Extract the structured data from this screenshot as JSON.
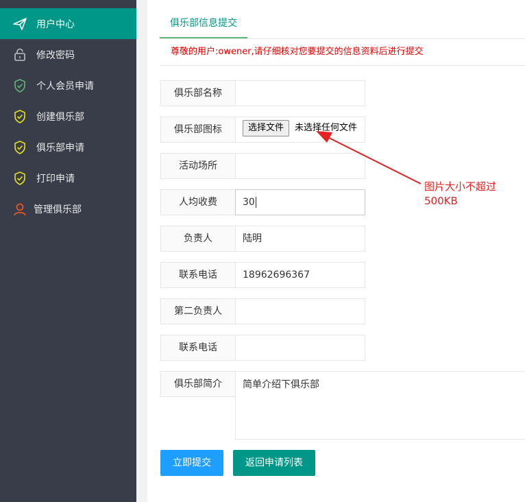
{
  "sidebar": {
    "items": [
      {
        "label": "用户中心",
        "icon": "paper-plane-icon",
        "active": true
      },
      {
        "label": "修改密码",
        "icon": "lock-icon"
      },
      {
        "label": "个人会员申请",
        "icon": "shield-check-icon"
      },
      {
        "label": "创建俱乐部",
        "icon": "shield-check-icon"
      },
      {
        "label": "俱乐部申请",
        "icon": "shield-check-icon"
      },
      {
        "label": "打印申请",
        "icon": "shield-check-icon"
      },
      {
        "label": "管理俱乐部",
        "icon": "user-icon"
      }
    ]
  },
  "tabs": {
    "active_label": "俱乐部信息提交"
  },
  "notice": "尊敬的用户:owener,请仔细核对您要提交的信息资料后进行提交",
  "form": {
    "club_name": {
      "label": "俱乐部名称",
      "value": ""
    },
    "club_icon": {
      "label": "俱乐部图标",
      "button": "选择文件",
      "status": "未选择任何文件"
    },
    "venue": {
      "label": "活动场所",
      "value": ""
    },
    "fee": {
      "label": "人均收费",
      "value": "30"
    },
    "leader": {
      "label": "负责人",
      "value": "陆明"
    },
    "phone": {
      "label": "联系电话",
      "value": "18962696367"
    },
    "second_leader": {
      "label": "第二负责人",
      "value": ""
    },
    "second_phone": {
      "label": "联系电话",
      "value": ""
    },
    "intro": {
      "label": "俱乐部简介",
      "value": "简单介绍下俱乐部"
    }
  },
  "buttons": {
    "submit": "立即提交",
    "back": "返回申请列表"
  },
  "annotation": {
    "line1": "图片大小不超过",
    "line2": "500KB"
  },
  "colors": {
    "sidebar_bg": "#393d49",
    "active_bg": "#009688",
    "primary_btn": "#1e9fff",
    "notice_red": "#e60000",
    "annotation_red": "#e62222"
  }
}
